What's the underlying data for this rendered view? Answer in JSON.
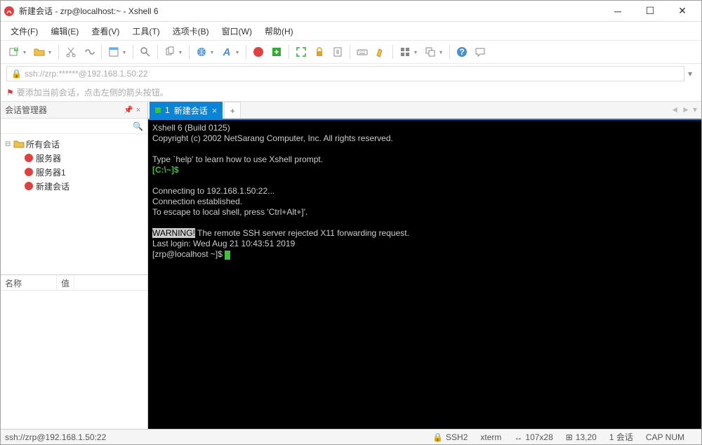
{
  "window": {
    "title": "新建会话 - zrp@localhost:~ - Xshell 6"
  },
  "menu": {
    "file": "文件(F)",
    "edit": "编辑(E)",
    "view": "查看(V)",
    "tools": "工具(T)",
    "tabs": "选项卡(B)",
    "window": "窗口(W)",
    "help": "帮助(H)"
  },
  "address": {
    "value": "ssh://zrp:******@192.168.1.50:22"
  },
  "tip": {
    "text": "要添加当前会话，点击左侧的箭头按钮。"
  },
  "sidebar": {
    "title": "会话管理器",
    "root": "所有会话",
    "items": [
      "服务器",
      "服务器1",
      "新建会话"
    ]
  },
  "props": {
    "col_name": "名称",
    "col_value": "值"
  },
  "tabs": {
    "active_index": "1",
    "active_label": "新建会话"
  },
  "terminal": {
    "line1": "Xshell 6 (Build 0125)",
    "line2": "Copyright (c) 2002 NetSarang Computer, Inc. All rights reserved.",
    "line3": "Type `help' to learn how to use Xshell prompt.",
    "prompt_local": "[C:\\~]$",
    "line5": "Connecting to 192.168.1.50:22...",
    "line6": "Connection established.",
    "line7": "To escape to local shell, press 'Ctrl+Alt+]'.",
    "warn_tag": "WARNING!",
    "warn_rest": " The remote SSH server rejected X11 forwarding request.",
    "last_login": "Last login: Wed Aug 21 10:43:51 2019",
    "prompt_remote": "[zrp@localhost ~]$ "
  },
  "status": {
    "left": "ssh://zrp@192.168.1.50:22",
    "proto": "SSH2",
    "term": "xterm",
    "size": "107x28",
    "cursor": "13,20",
    "sess": "1 会话",
    "caps_num": "CAP   NUM"
  }
}
